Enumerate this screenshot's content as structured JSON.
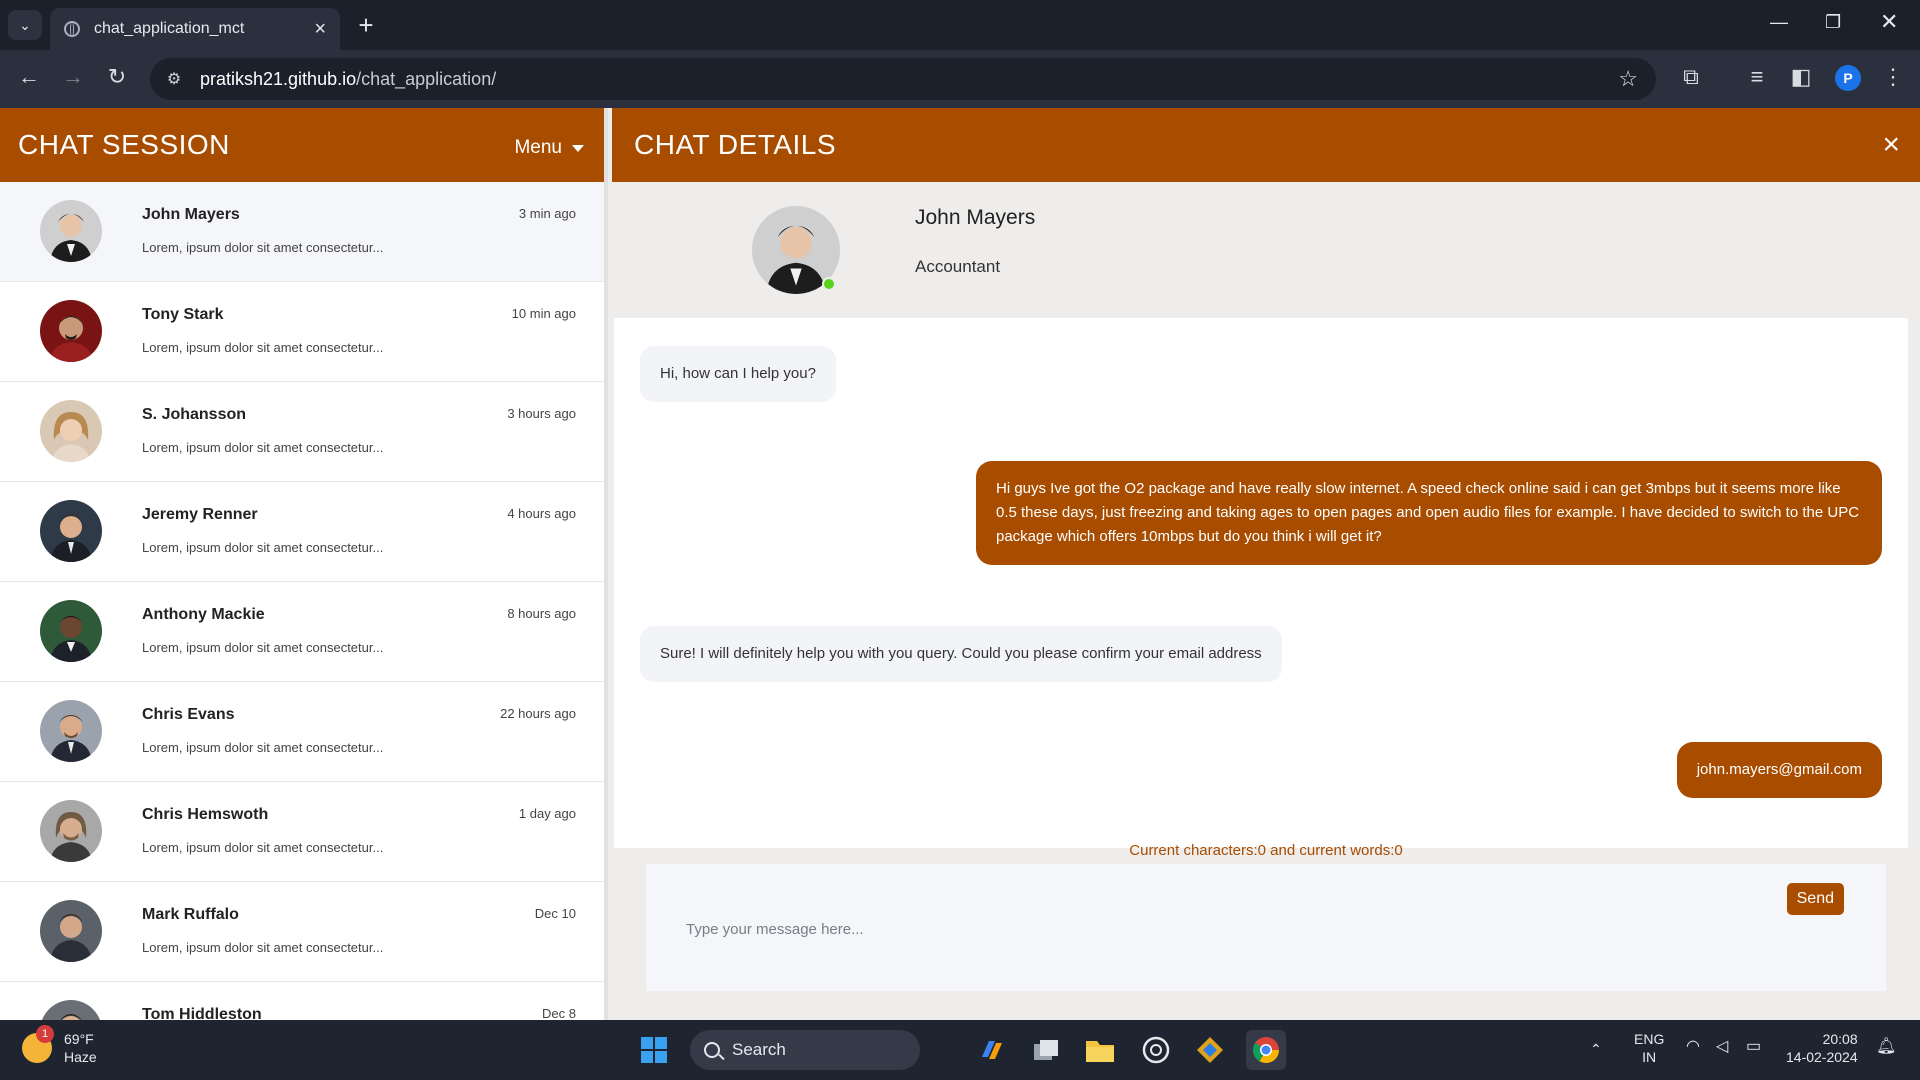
{
  "browser": {
    "tab_title": "chat_application_mct",
    "url_host": "pratiksh21.github.io",
    "url_path": "/chat_application/",
    "profile_initial": "P"
  },
  "left_panel": {
    "title": "CHAT SESSION",
    "menu_label": "Menu",
    "contacts": [
      {
        "name": "John Mayers",
        "time": "3 min ago",
        "preview": "Lorem, ipsum dolor sit amet consectetur...",
        "active": true
      },
      {
        "name": "Tony Stark",
        "time": "10 min ago",
        "preview": "Lorem, ipsum dolor sit amet consectetur..."
      },
      {
        "name": "S. Johansson",
        "time": "3 hours ago",
        "preview": "Lorem, ipsum dolor sit amet consectetur..."
      },
      {
        "name": "Jeremy Renner",
        "time": "4 hours ago",
        "preview": "Lorem, ipsum dolor sit amet consectetur..."
      },
      {
        "name": "Anthony Mackie",
        "time": "8 hours ago",
        "preview": "Lorem, ipsum dolor sit amet consectetur..."
      },
      {
        "name": "Chris Evans",
        "time": "22 hours ago",
        "preview": "Lorem, ipsum dolor sit amet consectetur..."
      },
      {
        "name": "Chris Hemswoth",
        "time": "1 day ago",
        "preview": "Lorem, ipsum dolor sit amet consectetur..."
      },
      {
        "name": "Mark Ruffalo",
        "time": "Dec 10",
        "preview": "Lorem, ipsum dolor sit amet consectetur..."
      },
      {
        "name": "Tom Hiddleston",
        "time": "Dec 8",
        "preview": ""
      }
    ]
  },
  "right_panel": {
    "title": "CHAT DETAILS",
    "close_icon": "×",
    "profile": {
      "name": "John Mayers",
      "role": "Accountant"
    },
    "messages": [
      {
        "dir": "in",
        "text": "Hi, how can I help you?"
      },
      {
        "dir": "out",
        "text": "Hi guys Ive got the O2 package and have really slow internet. A speed check online said i can get 3mbps but it seems more like 0.5 these days, just freezing and taking ages to open pages and open audio files for example. I have decided to switch to the UPC package which offers 10mbps but do you think i will get it?"
      },
      {
        "dir": "in",
        "text": "Sure! I will definitely help you with you query. Could you please confirm your email address"
      },
      {
        "dir": "out",
        "text": "john.mayers@gmail.com"
      }
    ],
    "counter": "Current characters:0 and current words:0",
    "input_placeholder": "Type your message here...",
    "send_label": "Send"
  },
  "taskbar": {
    "weather_temp": "69°F",
    "weather_desc": "Haze",
    "weather_badge": "1",
    "search_label": "Search",
    "lang_line1": "ENG",
    "lang_line2": "IN",
    "time": "20:08",
    "date": "14-02-2024"
  },
  "colors": {
    "accent": "#a84c00",
    "online": "#57d31a"
  }
}
